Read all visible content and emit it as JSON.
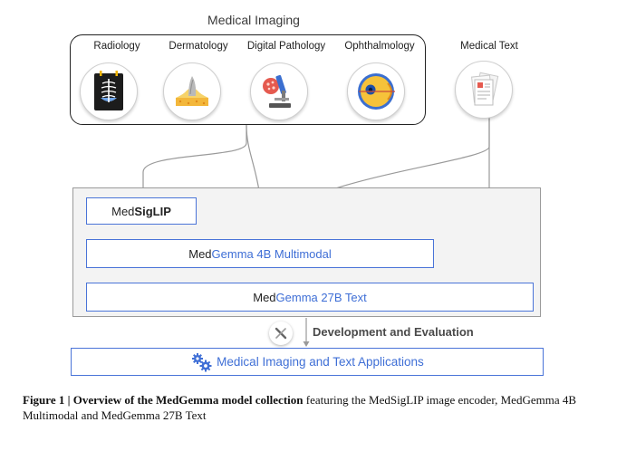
{
  "diagram": {
    "imaging_title": "Medical Imaging",
    "modalities": [
      {
        "label": "Radiology",
        "icon": "radiology-xray-icon"
      },
      {
        "label": "Dermatology",
        "icon": "dermatology-skin-icon"
      },
      {
        "label": "Digital Pathology",
        "icon": "pathology-microscope-icon"
      },
      {
        "label": "Ophthalmology",
        "icon": "ophthalmology-eye-icon"
      }
    ],
    "text_source": {
      "label": "Medical Text",
      "icon": "medical-documents-icon"
    },
    "models": {
      "siglip": {
        "prefix": "Med",
        "suffix": "SigLIP"
      },
      "multimodal": {
        "prefix": "Med",
        "brand": "Gemma",
        "suffix": " 4B Multimodal"
      },
      "text27b": {
        "prefix": "Med",
        "brand": "Gemma",
        "suffix": " 27B Text"
      }
    },
    "dev_label": "Development and Evaluation",
    "applications_label": "Medical Imaging and Text Applications"
  },
  "caption": {
    "label": "Figure 1 | Overview of the MedGemma model collection",
    "text": " featuring the MedSigLIP image encoder, MedGemma 4B Multimodal and MedGemma 27B Text"
  }
}
